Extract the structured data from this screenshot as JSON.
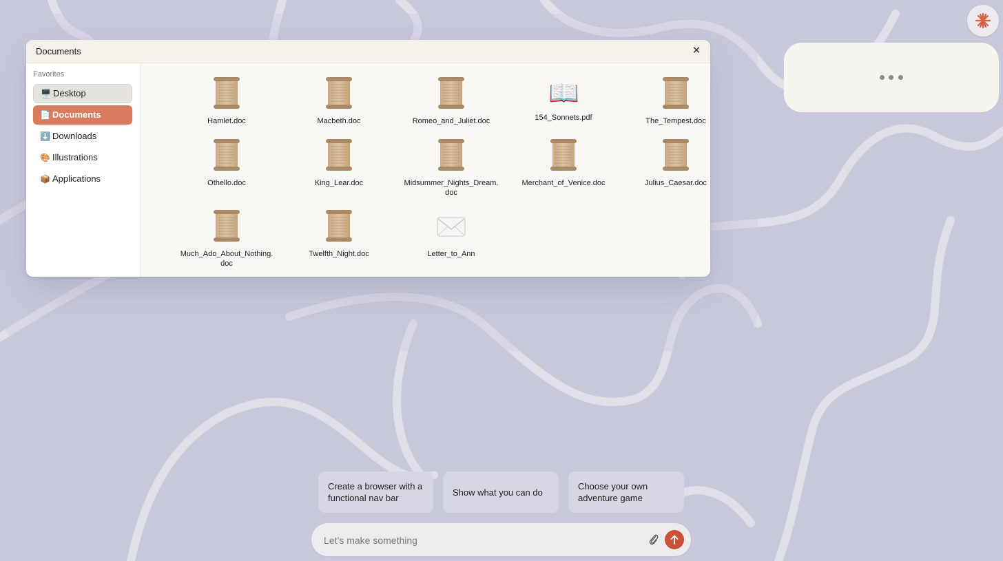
{
  "window": {
    "title": "Documents",
    "close_symbol": "✕"
  },
  "sidebar": {
    "section_label": "Favorites",
    "items": [
      {
        "emoji": "🖥️",
        "label": "Desktop",
        "state": "hover"
      },
      {
        "emoji": "📄",
        "label": "Documents",
        "state": "active"
      },
      {
        "emoji": "⬇️",
        "label": "Downloads",
        "state": "normal"
      },
      {
        "emoji": "🎨",
        "label": "Illustrations",
        "state": "normal"
      },
      {
        "emoji": "📦",
        "label": "Applications",
        "state": "normal"
      }
    ]
  },
  "files": [
    {
      "name": "Hamlet.doc",
      "icon": "scroll-icon"
    },
    {
      "name": "Macbeth.doc",
      "icon": "scroll-icon"
    },
    {
      "name": "Romeo_and_Juliet.doc",
      "icon": "scroll-icon"
    },
    {
      "name": "154_Sonnets.pdf",
      "icon": "open-book-icon",
      "emoji": "📖"
    },
    {
      "name": "The_Tempest.doc",
      "icon": "scroll-icon"
    },
    {
      "name": "Othello.doc",
      "icon": "scroll-icon"
    },
    {
      "name": "King_Lear.doc",
      "icon": "scroll-icon"
    },
    {
      "name": "Midsummer_Nights_Dream.doc",
      "icon": "scroll-icon"
    },
    {
      "name": "Merchant_of_Venice.doc",
      "icon": "scroll-icon"
    },
    {
      "name": "Julius_Caesar.doc",
      "icon": "scroll-icon"
    },
    {
      "name": "Much_Ado_About_Nothing.doc",
      "icon": "scroll-icon"
    },
    {
      "name": "Twelfth_Night.doc",
      "icon": "scroll-icon"
    },
    {
      "name": "Letter_to_Ann",
      "icon": "envelope-icon",
      "emoji": "✉️"
    }
  ],
  "suggestions": [
    "Create a browser with a functional nav bar",
    "Show what you can do",
    "Choose your own adventure game"
  ],
  "prompt": {
    "placeholder": "Let’s make something"
  },
  "colors": {
    "background": "#c9c9dc",
    "accent": "#d97b5c",
    "send_button": "#c9533a",
    "logo": "#d9603f"
  }
}
